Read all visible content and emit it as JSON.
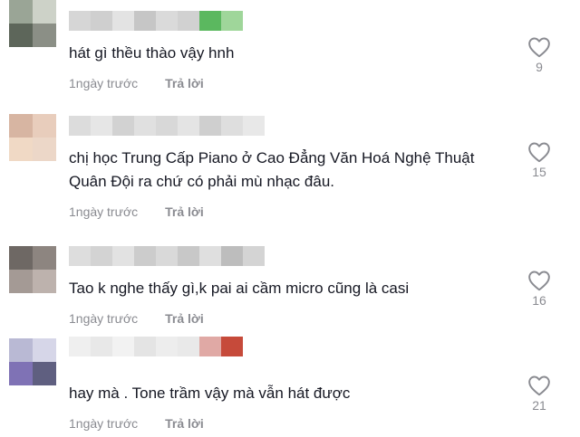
{
  "comments": [
    {
      "text": "hát gì thều thào vậy hnh",
      "time": "1ngày trước",
      "reply": "Trả lời",
      "likes": "9",
      "avatar_colors": [
        "#9aa596",
        "#cdd2c8",
        "#5d665a",
        "#8b8f86"
      ],
      "name_colors": [
        "#d6d6d6",
        "#cfcfcf",
        "#e3e3e3",
        "#c6c6c6",
        "#dadada",
        "#d1d1d1",
        "#5bb85f",
        "#9fd69a"
      ]
    },
    {
      "text": "chị học Trung Cấp Piano ở Cao Đẳng Văn Hoá Nghệ Thuật Quân Đội ra chứ có phải mù nhạc đâu.",
      "time": "1ngày trước",
      "reply": "Trả lời",
      "likes": "15",
      "avatar_colors": [
        "#d7b5a2",
        "#e8cdbc",
        "#f0d9c5",
        "#ecd7c8"
      ],
      "name_colors": [
        "#dcdcdc",
        "#e6e6e6",
        "#d2d2d2",
        "#e0e0e0",
        "#d8d8d8",
        "#e4e4e4",
        "#cfcfcf",
        "#dedede",
        "#e8e8e8"
      ]
    },
    {
      "text": "Tao k nghe thấy gì,k pai ai cầm micro cũng là casi",
      "time": "1ngày trước",
      "reply": "Trả lời",
      "likes": "16",
      "avatar_colors": [
        "#6e6864",
        "#8d8580",
        "#a49a95",
        "#bdb2ad"
      ],
      "name_colors": [
        "#dddddd",
        "#d3d3d3",
        "#e2e2e2",
        "#cccccc",
        "#d9d9d9",
        "#c8c8c8",
        "#dfdfdf",
        "#bdbdbd",
        "#d4d4d4"
      ]
    },
    {
      "text": "hay mà . Tone trầm vậy mà vẫn hát được",
      "time": "1ngày trước",
      "reply": "Trả lời",
      "likes": "21",
      "avatar_colors": [
        "#b9b9d4",
        "#d6d6e8",
        "#7f72b5",
        "#5f5f80"
      ],
      "name_colors": [
        "#efefef",
        "#e8e8e8",
        "#f2f2f2",
        "#e4e4e4",
        "#ededed",
        "#e9e9e9",
        "#e0a9a5",
        "#c64a3a"
      ]
    }
  ]
}
